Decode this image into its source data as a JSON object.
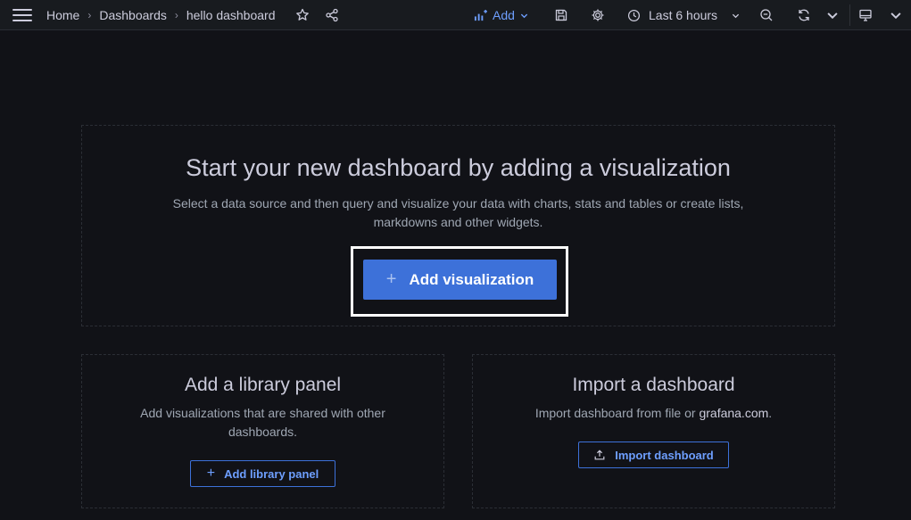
{
  "topbar": {
    "breadcrumbs": [
      "Home",
      "Dashboards",
      "hello dashboard"
    ],
    "add_label": "Add",
    "time_range": "Last 6 hours"
  },
  "hero": {
    "title": "Start your new dashboard by adding a visualization",
    "description": "Select a data source and then query and visualize your data with charts, stats and tables or create lists, markdowns and other widgets.",
    "button_label": "Add visualization"
  },
  "library": {
    "title": "Add a library panel",
    "description": "Add visualizations that are shared with other dashboards.",
    "button_label": "Add library panel"
  },
  "import": {
    "title": "Import a dashboard",
    "description_prefix": "Import dashboard from file or ",
    "link_text": "grafana.com",
    "description_suffix": ".",
    "button_label": "Import dashboard"
  },
  "colors": {
    "background": "#111217",
    "topbar": "#181b1f",
    "primary": "#3d71d9",
    "link": "#6e9fff"
  }
}
